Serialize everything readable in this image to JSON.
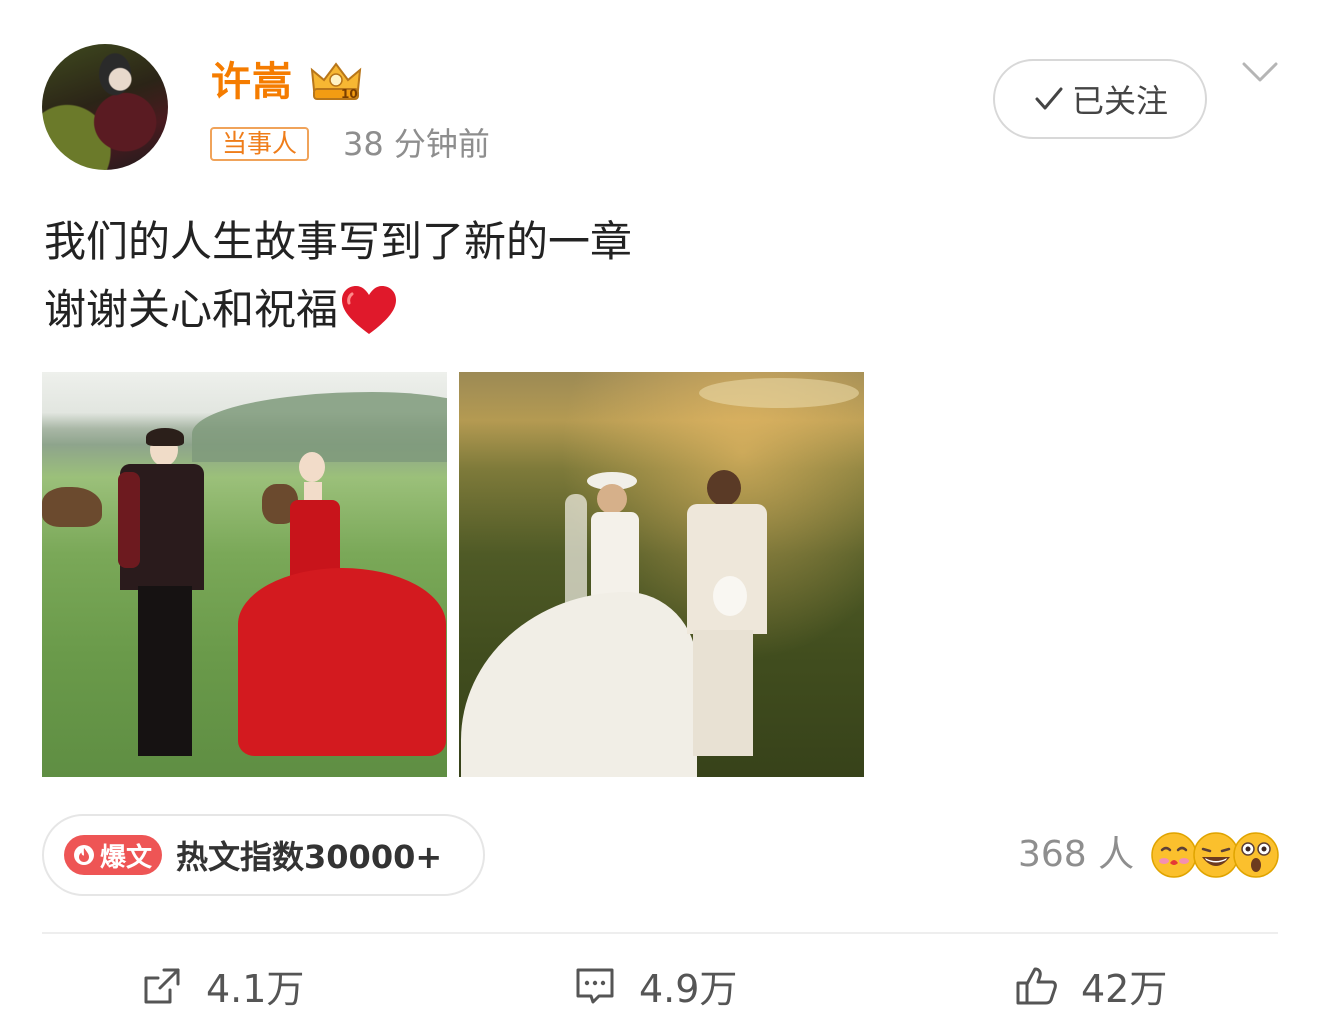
{
  "post": {
    "author": "许嵩",
    "tag": "当事人",
    "time": "38 分钟前",
    "follow_label": "已关注",
    "text_lines": [
      "我们的人生故事写到了新的一章",
      "谢谢关心和祝福"
    ],
    "photos": [
      "photo-red-dress-grassland",
      "photo-white-gown-sunset"
    ]
  },
  "hot": {
    "badge_label": "爆文",
    "index_text": "热文指数30000+"
  },
  "reactions": {
    "count_text": "368 人",
    "emojis": [
      "kiss-emoji",
      "laugh-emoji",
      "shocked-emoji"
    ]
  },
  "actions": {
    "repost": "4.1万",
    "comment": "4.9万",
    "like": "42万"
  },
  "colors": {
    "author_name": "#f57c00",
    "tag": "#ef7d1a",
    "hot_badge": "#ee5555",
    "heart": "#e0192b"
  }
}
